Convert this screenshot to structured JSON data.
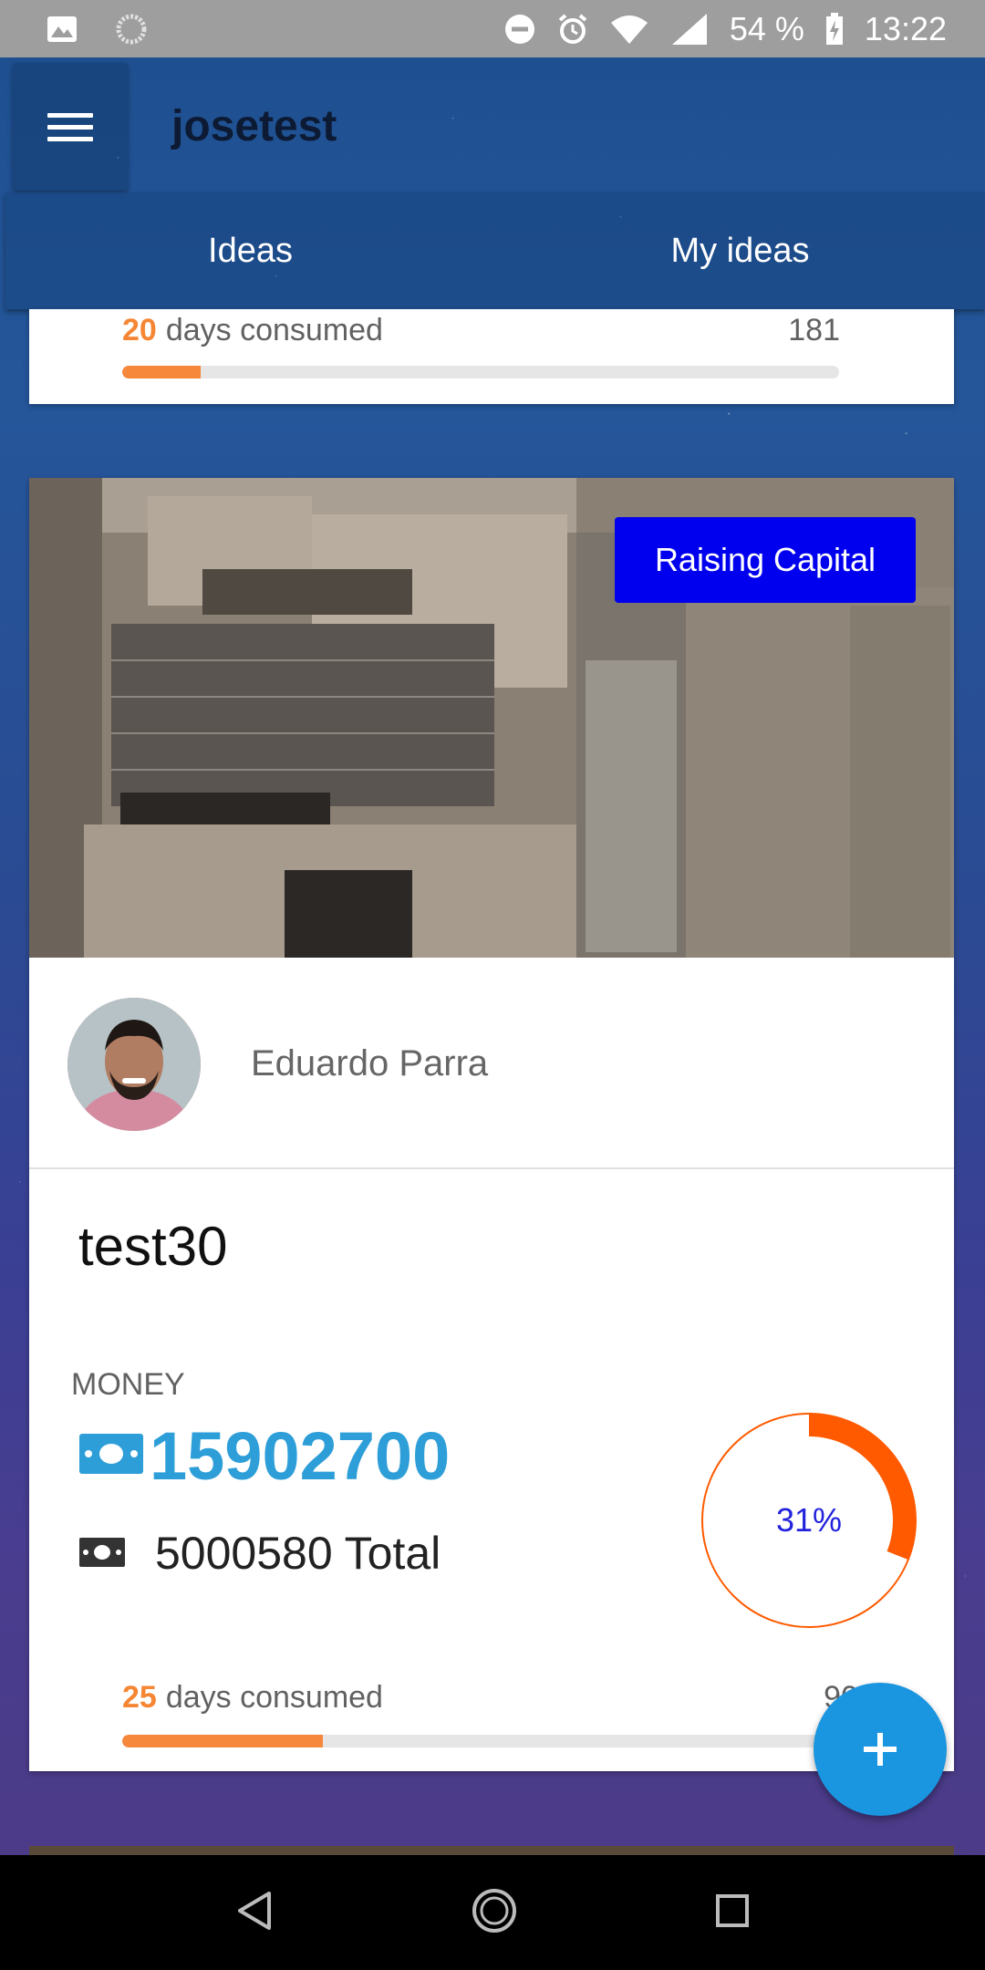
{
  "status_bar": {
    "battery": "54 %",
    "time": "13:22",
    "icons": [
      "image-icon",
      "loading-icon",
      "dnd-icon",
      "alarm-icon",
      "wifi-icon",
      "signal-icon",
      "battery-icon"
    ]
  },
  "app_bar": {
    "title": "josetest",
    "menu_icon": "menu-icon"
  },
  "tabs": [
    {
      "label": "Ideas"
    },
    {
      "label": "My ideas"
    }
  ],
  "prev_card": {
    "days_consumed": "20",
    "days_label": "days consumed",
    "days_total": "181",
    "progress": 0.11
  },
  "idea_card": {
    "status_badge": "Raising Capital",
    "author_name": "Eduardo Parra",
    "title": "test30",
    "money_label": "MONEY",
    "money_raised": "15902700",
    "money_total": "5000580 Total",
    "percent_label": "31%",
    "percent": 0.31,
    "days_consumed": "25",
    "days_label": "days consumed",
    "days_total": "90",
    "progress": 0.28,
    "colors": {
      "accent": "#2d9ed8",
      "donut": "#ff5a00",
      "badge": "#0000ee",
      "progress": "#f5883b"
    }
  },
  "fab": {
    "icon": "plus-icon"
  },
  "nav_bar": {
    "icons": [
      "back-icon",
      "home-icon",
      "recents-icon"
    ]
  }
}
